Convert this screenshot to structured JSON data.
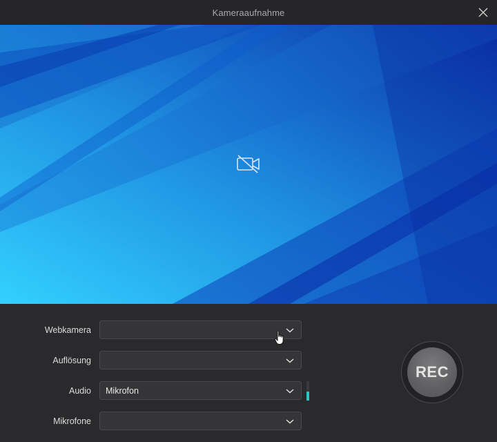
{
  "window": {
    "title": "Kameraaufnahme"
  },
  "icons": {
    "close": "close-icon",
    "camera_off": "camera-off-icon",
    "chevron": "chevron-down-icon",
    "cursor": "hand-pointer-cursor"
  },
  "colors": {
    "accent_level": "#2ec4c4",
    "preview_light": "#2fc6f5",
    "preview_dark": "#0a2fa8"
  },
  "settings": {
    "webcam": {
      "label": "Webkamera",
      "value": ""
    },
    "resolution": {
      "label": "Auflösung",
      "value": ""
    },
    "audio": {
      "label": "Audio",
      "value": "Mikrofon",
      "level_fraction": 0.45
    },
    "microphones": {
      "label": "Mikrofone",
      "value": ""
    }
  },
  "record": {
    "label": "REC"
  }
}
